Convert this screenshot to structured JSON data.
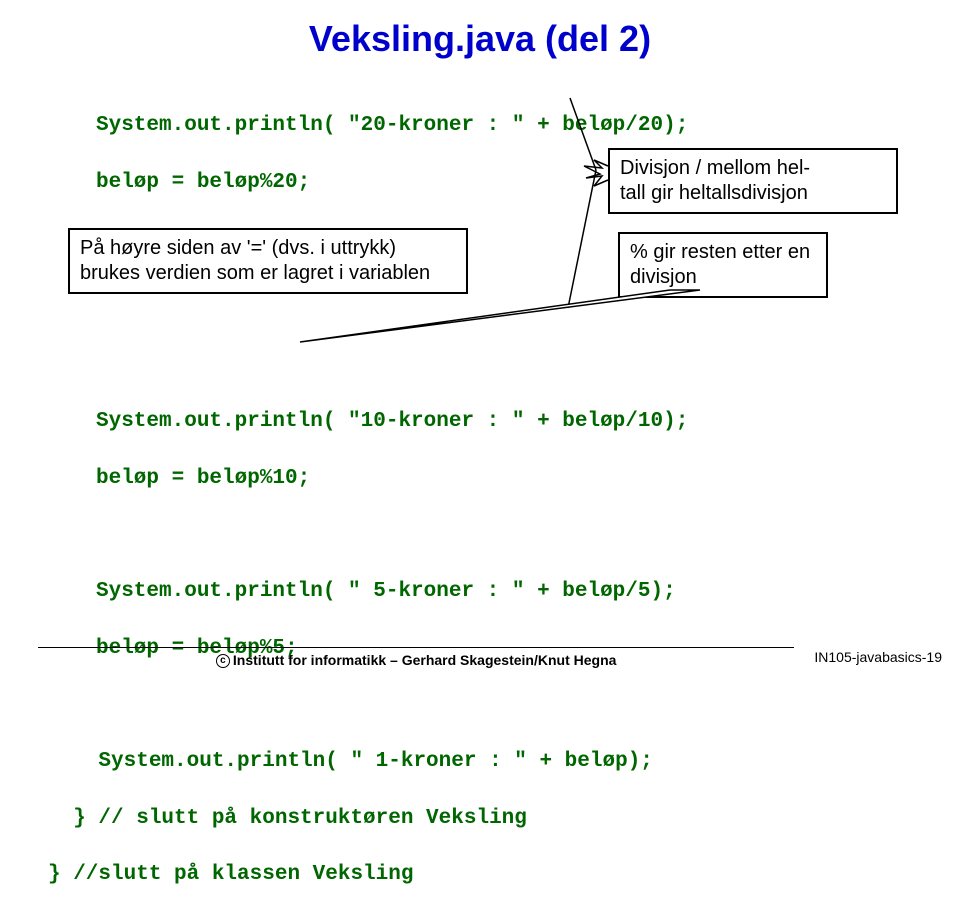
{
  "title": "Veksling.java (del 2)",
  "code": {
    "block1_line1": "System.out.println( \"20-kroner : \" + beløp/20);",
    "block1_line2": "beløp = beløp%20;",
    "block2_line1": "System.out.println( \"10-kroner : \" + beløp/10);",
    "block2_line2": "beløp = beløp%10;",
    "block3_line1": "System.out.println( \" 5-kroner : \" + beløp/5);",
    "block3_line2": "beløp = beløp%5;",
    "block4_line1": "    System.out.println( \" 1-kroner : \" + beløp);",
    "block4_line2": "  } // slutt på konstruktøren Veksling",
    "block4_line3": "} //slutt på klassen Veksling"
  },
  "annotations": {
    "division": "Divisjon / mellom hel-\ntall gir heltallsdivisjon",
    "leftbox": "På høyre siden av '=' (dvs. i uttrykk) brukes verdien som er lagret i variablen",
    "percent": "% gir resten etter en divisjon"
  },
  "footer": {
    "center": "Institutt for informatikk – Gerhard Skagestein/Knut Hegna",
    "right": "IN105-javabasics-19"
  }
}
